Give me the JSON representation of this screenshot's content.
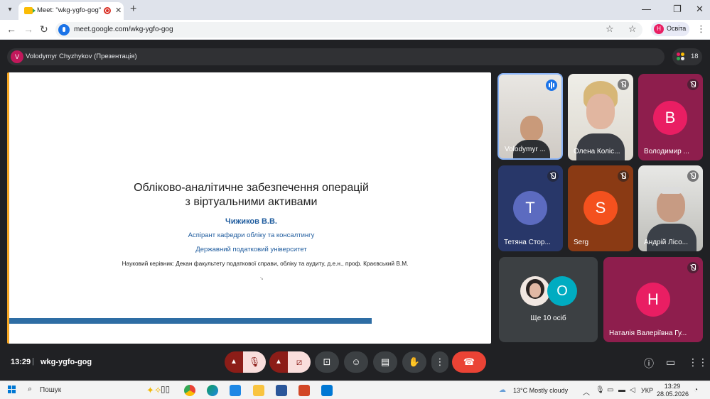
{
  "browser": {
    "tab_title": "Meet: \"wkg-ygfo-gog\"",
    "tab_close": "✕",
    "new_tab": "+",
    "url": "meet.google.com/wkg-ygfo-gog",
    "profile_initial": "Н",
    "profile_name": "Освіта",
    "window_controls": [
      "—",
      "❐",
      "✕"
    ],
    "nav": [
      "←",
      "→",
      "↻"
    ]
  },
  "meet": {
    "presenter_initial": "V",
    "presenter_label": "Volodymyr Chyzhykov (Презентація)",
    "participants_count": "18",
    "clock": "13:29",
    "meeting_code": "wkg-ygfo-gog"
  },
  "slide": {
    "title_line1": "Обліково-аналітичне забезпечення операцій",
    "title_line2": "з віртуальними активами",
    "author": "Чижиков В.В.",
    "line1": "Аспірант кафедри обліку та консалтингу",
    "line2": "Державний податковий університет",
    "supervisor": "Науковий керівник: Декан факультету податкової справи, обліку та аудиту, д.е.н., проф. Краєвський В.М.",
    "accent_color": "#f5a623",
    "bar_color": "#2e6da4"
  },
  "tiles": [
    {
      "name": "Volodymyr ...",
      "type": "video",
      "speaking": true
    },
    {
      "name": "Олена Коліс...",
      "type": "video",
      "muted": true
    },
    {
      "name": "Володимир ...",
      "type": "avatar",
      "initial": "В",
      "color": "#e91e63",
      "muted": true
    },
    {
      "name": "Тетяна Стор...",
      "type": "avatar",
      "initial": "Т",
      "color": "#5c6bc0",
      "muted": true
    },
    {
      "name": "Serg",
      "type": "avatar",
      "initial": "S",
      "color": "#f4511e",
      "muted": true
    },
    {
      "name": "Андрій Лісо...",
      "type": "video",
      "muted": true
    },
    {
      "name": "Ще 10 осіб",
      "type": "group",
      "initial": "O",
      "color": "#00acc1"
    },
    {
      "name": "Наталія Валеріївна Гу...",
      "type": "avatar",
      "initial": "Н",
      "color": "#e91e63",
      "muted": true
    }
  ],
  "taskbar": {
    "search_label": "Пошук",
    "weather": "13°C  Mostly cloudy",
    "language": "УКР",
    "time": "13:29",
    "date": "28.05.2026"
  },
  "colors": {
    "meet_bg": "#202124",
    "end_call": "#ea4335",
    "muted_ctrl": "#f9dedc",
    "muted_ctrl_side": "#8c1d18"
  }
}
